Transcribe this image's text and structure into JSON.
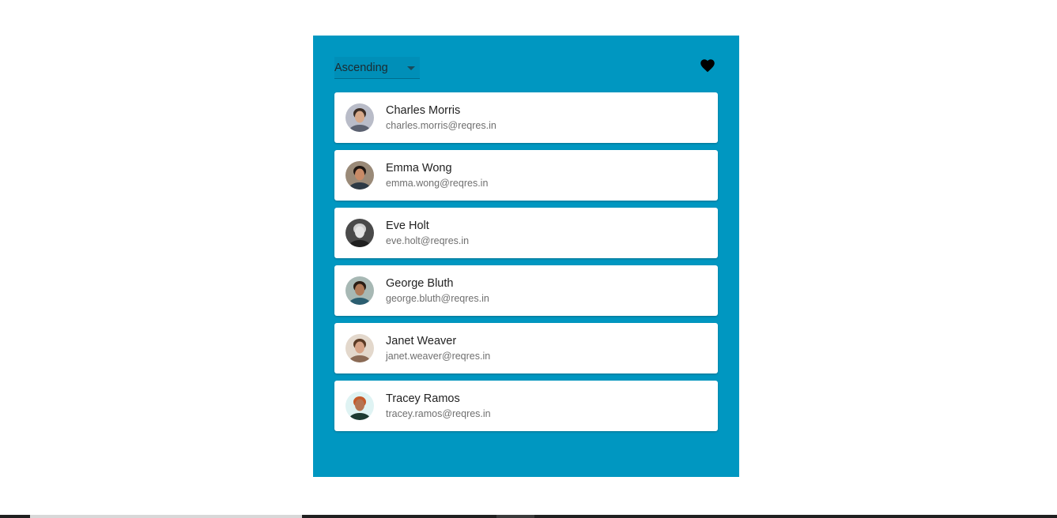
{
  "sort": {
    "selected": "Ascending"
  },
  "favorites_icon": "heart-icon",
  "users": [
    {
      "name": "Charles Morris",
      "email": "charles.morris@reqres.in",
      "bg": "#b9bcc8",
      "skin": "#d7a98a",
      "hair": "#3a2c24",
      "shirt": "#5b6170"
    },
    {
      "name": "Emma Wong",
      "email": "emma.wong@reqres.in",
      "bg": "#9a8a78",
      "skin": "#c88a66",
      "hair": "#1e1612",
      "shirt": "#2d3a45"
    },
    {
      "name": "Eve Holt",
      "email": "eve.holt@reqres.in",
      "bg": "#4a4a4a",
      "skin": "#e4e4e4",
      "hair": "#d0d0d0",
      "shirt": "#202020"
    },
    {
      "name": "George Bluth",
      "email": "george.bluth@reqres.in",
      "bg": "#a7b8b4",
      "skin": "#b07a58",
      "hair": "#2a1d14",
      "shirt": "#2b5e70"
    },
    {
      "name": "Janet Weaver",
      "email": "janet.weaver@reqres.in",
      "bg": "#e3d8cc",
      "skin": "#d6a386",
      "hair": "#5a3a24",
      "shirt": "#8a6a55"
    },
    {
      "name": "Tracey Ramos",
      "email": "tracey.ramos@reqres.in",
      "bg": "#dff3f3",
      "skin": "#b57452",
      "hair": "#c65a2a",
      "shirt": "#1d3a32"
    }
  ],
  "colors": {
    "panel": "#0097c1",
    "card": "#ffffff"
  }
}
